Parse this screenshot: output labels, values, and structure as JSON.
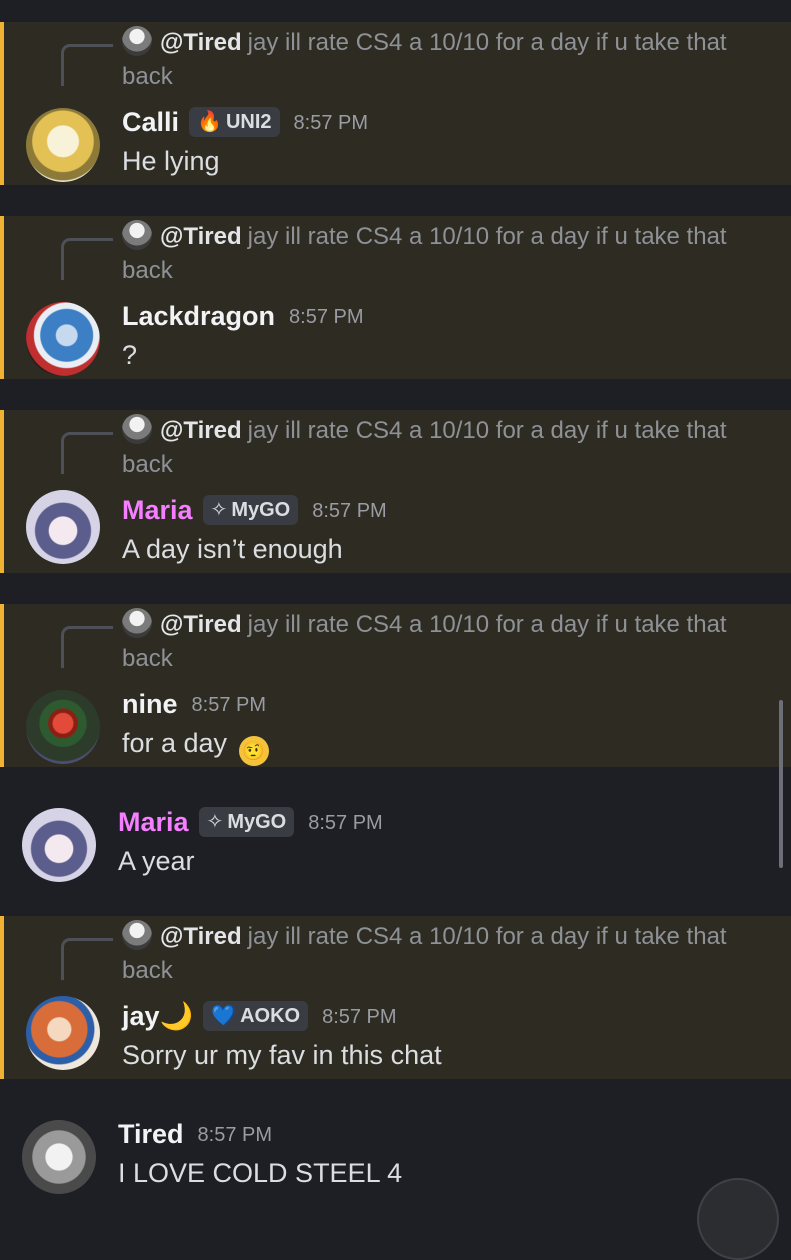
{
  "messages": [
    {
      "reply": {
        "user": "@Tired",
        "text": "jay ill rate CS4 a 10/10 for a day if u take that back"
      },
      "author": "Calli",
      "tag": {
        "icon": "fire-icon",
        "label": "UNI2",
        "glyph": "🔥"
      },
      "time": "8:57 PM",
      "text": "He lying"
    },
    {
      "reply": {
        "user": "@Tired",
        "text": "jay ill rate CS4 a 10/10 for a day if u take that back"
      },
      "author": "Lackdragon",
      "time": "8:57 PM",
      "text": "?"
    },
    {
      "reply": {
        "user": "@Tired",
        "text": "jay ill rate CS4 a 10/10 for a day if u take that back"
      },
      "author": "Maria",
      "tag": {
        "icon": "diamond-icon",
        "label": "MyGO",
        "glyph": "✧"
      },
      "time": "8:57 PM",
      "text": "A day isn’t enough"
    },
    {
      "reply": {
        "user": "@Tired",
        "text": "jay ill rate CS4 a 10/10 for a day if u take that back"
      },
      "author": "nine",
      "time": "8:57 PM",
      "text": "for a day",
      "emoji": "🤨"
    },
    {
      "author": "Maria",
      "tag": {
        "icon": "diamond-icon",
        "label": "MyGO",
        "glyph": "✧"
      },
      "time": "8:57 PM",
      "text": "A year"
    },
    {
      "reply": {
        "user": "@Tired",
        "text": "jay ill rate CS4 a 10/10 for a day if u take that back"
      },
      "author": "jay",
      "author_suffix": "🌙",
      "tag": {
        "icon": "heart-icon",
        "label": "AOKO",
        "glyph": "💙"
      },
      "time": "8:57 PM",
      "text": "Sorry ur my fav in this chat"
    },
    {
      "author": "Tired",
      "time": "8:57 PM",
      "text": "I LOVE COLD STEEL 4"
    }
  ],
  "colors": {
    "mention_bg": "#2e2b22",
    "mention_bar": "#f0b232",
    "role_pink": "#f47fff",
    "background": "#1e1f24"
  }
}
